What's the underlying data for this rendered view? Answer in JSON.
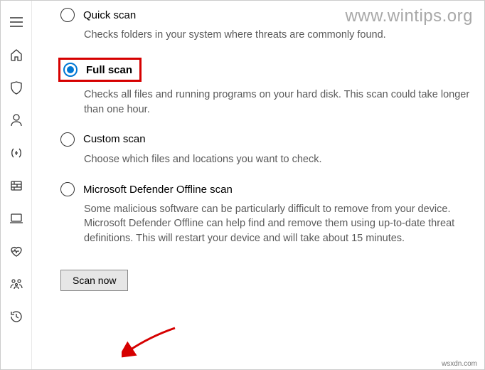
{
  "watermark": "www.wintips.org",
  "credit": "wsxdn.com",
  "sidebar": {
    "items": [
      "menu",
      "home",
      "shield",
      "account",
      "network",
      "firewall",
      "device",
      "health",
      "family",
      "history"
    ]
  },
  "options": [
    {
      "title": "Quick scan",
      "desc": "Checks folders in your system where threats are commonly found.",
      "selected": false
    },
    {
      "title": "Full scan",
      "desc": "Checks all files and running programs on your hard disk. This scan could take longer than one hour.",
      "selected": true
    },
    {
      "title": "Custom scan",
      "desc": "Choose which files and locations you want to check.",
      "selected": false
    },
    {
      "title": "Microsoft Defender Offline scan",
      "desc": "Some malicious software can be particularly difficult to remove from your device. Microsoft Defender Offline can help find and remove them using up-to-date threat definitions. This will restart your device and will take about 15 minutes.",
      "selected": false
    }
  ],
  "scan_button": "Scan now"
}
